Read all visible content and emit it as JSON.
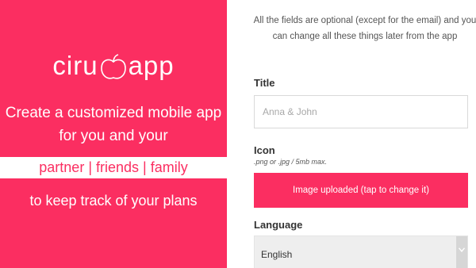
{
  "brand": {
    "logo_left": "ciru",
    "logo_right": "app",
    "logo_mark_icon": "apple-icon"
  },
  "promo": {
    "line1": "Create a customized mobile app",
    "line2": "for you and your",
    "highlight": "partner | friends | family",
    "line3": "to keep track of your plans"
  },
  "form": {
    "notice": "All the fields are optional (except for the email) and you can change all these things later from the app",
    "title_label": "Title",
    "title_placeholder": "Anna & John",
    "icon_label": "Icon",
    "icon_hint": ".png or .jpg / 5mb max.",
    "upload_button_label": "Image uploaded (tap to change it)",
    "language_label": "Language",
    "language_selected": "English",
    "dropdown_icon": "chevron-down-icon"
  },
  "colors": {
    "brand": "#fb2e61",
    "background": "#ffffff",
    "input_border": "#d9d9d9",
    "select_background": "#eeeeee"
  }
}
